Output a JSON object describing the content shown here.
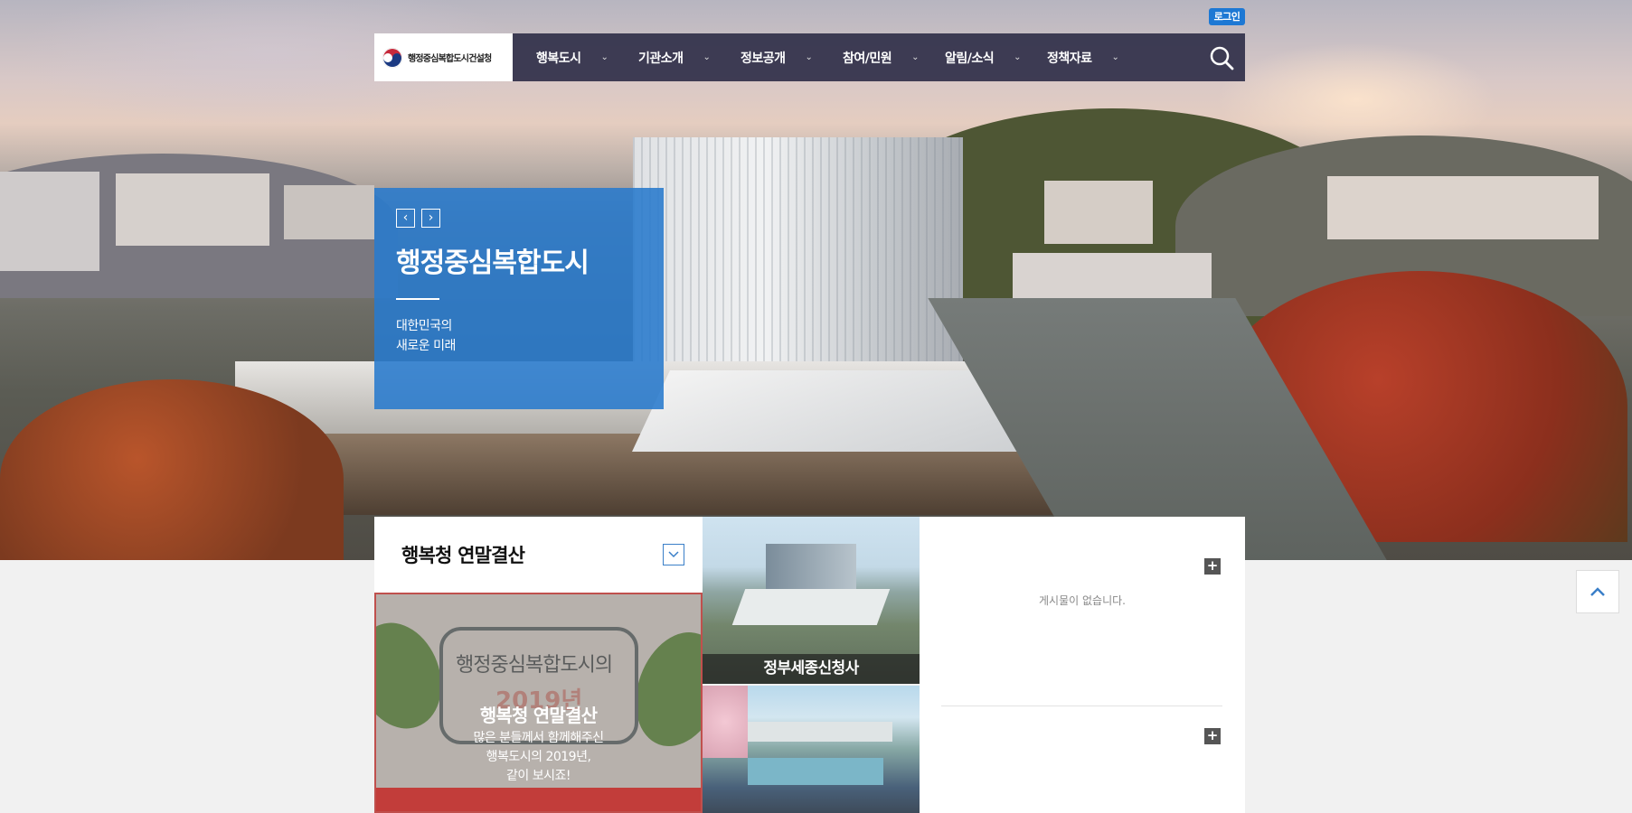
{
  "header": {
    "login_label": "로그인",
    "logo_text": "행정중심복합도시건설청",
    "menu": [
      {
        "label": "행복도시"
      },
      {
        "label": "기관소개"
      },
      {
        "label": "정보공개"
      },
      {
        "label": "참여/민원"
      },
      {
        "label": "알림/소식"
      },
      {
        "label": "정책자료"
      }
    ],
    "search_icon": "search-icon"
  },
  "hero": {
    "prev_symbol": "‹",
    "next_symbol": "›",
    "title": "행정중심복합도시",
    "subtitle_line1": "대한민국의",
    "subtitle_line2": "새로운 미래"
  },
  "notice_panel": {
    "title": "행복청 연말결산",
    "dropdown_icon": "chevron-down-icon",
    "banner": {
      "title": "행복청 연말결산",
      "desc_line1": "많은 분들께서 함께해주신",
      "desc_line2": "행복도시의 2019년,",
      "desc_line3": "같이 보시죠!"
    }
  },
  "photos": {
    "photo1_label": "정부세종신청사"
  },
  "board": {
    "empty_message": "게시물이 없습니다.",
    "plus_symbol": "+"
  },
  "scroll_top_symbol": "^",
  "colors": {
    "nav_bg": "#32304a",
    "accent_blue": "#287acd",
    "login_blue": "#1d78d4"
  }
}
